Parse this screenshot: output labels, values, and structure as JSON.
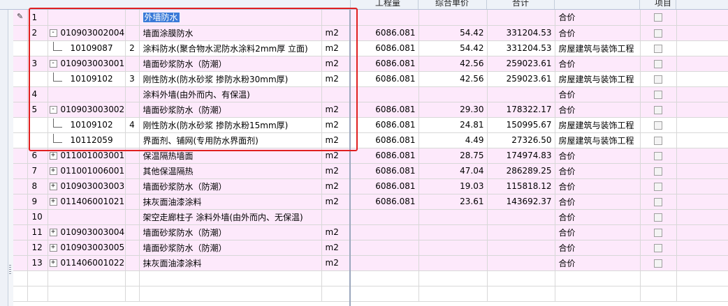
{
  "header": {
    "quantity": "工程量",
    "unit_price": "综合单价",
    "total": "合计",
    "item": "项目"
  },
  "rows": [
    {
      "idx": "1",
      "code": "",
      "seq": "",
      "name": "外墙防水",
      "unit": "",
      "qty": "",
      "price": "",
      "total": "",
      "type": "合价",
      "bg": "pink",
      "tree": "none",
      "selected": true
    },
    {
      "idx": "2",
      "code": "010903002004",
      "seq": "",
      "name": "墙面涂膜防水",
      "unit": "m2",
      "qty": "6086.081",
      "price": "54.42",
      "total": "331204.53",
      "type": "合价",
      "bg": "pink",
      "tree": "minus"
    },
    {
      "idx": "",
      "code": "10109087",
      "seq": "2",
      "name": "涂料防水(聚合物水泥防水涂料2mm厚 立面)",
      "unit": "m2",
      "qty": "6086.081",
      "price": "54.42",
      "total": "331204.53",
      "type": "房屋建筑与装饰工程",
      "bg": "white",
      "tree": "child"
    },
    {
      "idx": "3",
      "code": "010903003001",
      "seq": "",
      "name": "墙面砂浆防水（防潮）",
      "unit": "m2",
      "qty": "6086.081",
      "price": "42.56",
      "total": "259023.61",
      "type": "合价",
      "bg": "pink",
      "tree": "minus"
    },
    {
      "idx": "",
      "code": "10109102",
      "seq": "3",
      "name": "刚性防水(防水砂浆 掺防水粉30mm厚)",
      "unit": "m2",
      "qty": "6086.081",
      "price": "42.56",
      "total": "259023.61",
      "type": "房屋建筑与装饰工程",
      "bg": "white",
      "tree": "child"
    },
    {
      "idx": "4",
      "code": "",
      "seq": "",
      "name": "涂料外墙(由外而内、有保温)",
      "unit": "",
      "qty": "",
      "price": "",
      "total": "",
      "type": "合价",
      "bg": "pink",
      "tree": "none"
    },
    {
      "idx": "5",
      "code": "010903003002",
      "seq": "",
      "name": "墙面砂浆防水（防潮）",
      "unit": "m2",
      "qty": "6086.081",
      "price": "29.30",
      "total": "178322.17",
      "type": "合价",
      "bg": "pink",
      "tree": "minus"
    },
    {
      "idx": "",
      "code": "10109102",
      "seq": "4",
      "name": "刚性防水(防水砂浆 掺防水粉15mm厚)",
      "unit": "m2",
      "qty": "6086.081",
      "price": "24.81",
      "total": "150995.67",
      "type": "房屋建筑与装饰工程",
      "bg": "white",
      "tree": "child"
    },
    {
      "idx": "",
      "code": "10112059",
      "seq": "",
      "name": "界面剂、铺网(专用防水界面剂)",
      "unit": "m2",
      "qty": "6086.081",
      "price": "4.49",
      "total": "27326.50",
      "type": "房屋建筑与装饰工程",
      "bg": "white",
      "tree": "child"
    },
    {
      "idx": "6",
      "code": "011001003001",
      "seq": "",
      "name": "保温隔热墙面",
      "unit": "m2",
      "qty": "6086.081",
      "price": "28.75",
      "total": "174974.83",
      "type": "合价",
      "bg": "pink",
      "tree": "plus"
    },
    {
      "idx": "7",
      "code": "011001006001",
      "seq": "",
      "name": "其他保温隔热",
      "unit": "m2",
      "qty": "6086.081",
      "price": "47.04",
      "total": "286289.25",
      "type": "合价",
      "bg": "pink",
      "tree": "plus"
    },
    {
      "idx": "8",
      "code": "010903003003",
      "seq": "",
      "name": "墙面砂浆防水（防潮）",
      "unit": "m2",
      "qty": "6086.081",
      "price": "19.03",
      "total": "115818.12",
      "type": "合价",
      "bg": "pink",
      "tree": "plus"
    },
    {
      "idx": "9",
      "code": "011406001021",
      "seq": "",
      "name": "抹灰面油漆涂料",
      "unit": "m2",
      "qty": "6086.081",
      "price": "23.61",
      "total": "143692.37",
      "type": "合价",
      "bg": "pink",
      "tree": "plus"
    },
    {
      "idx": "10",
      "code": "",
      "seq": "",
      "name": "架空走廊柱子 涂料外墙(由外而内、无保温)",
      "unit": "",
      "qty": "",
      "price": "",
      "total": "",
      "type": "合价",
      "bg": "pink",
      "tree": "none"
    },
    {
      "idx": "11",
      "code": "010903003004",
      "seq": "",
      "name": "墙面砂浆防水（防潮）",
      "unit": "m2",
      "qty": "",
      "price": "",
      "total": "",
      "type": "合价",
      "bg": "pink",
      "tree": "plus"
    },
    {
      "idx": "12",
      "code": "010903003005",
      "seq": "",
      "name": "墙面砂浆防水（防潮）",
      "unit": "m2",
      "qty": "",
      "price": "",
      "total": "",
      "type": "合价",
      "bg": "pink",
      "tree": "plus"
    },
    {
      "idx": "13",
      "code": "011406001022",
      "seq": "",
      "name": "抹灰面油漆涂料",
      "unit": "m2",
      "qty": "",
      "price": "",
      "total": "",
      "type": "合价",
      "bg": "pink",
      "tree": "plus"
    }
  ],
  "tree_icons": {
    "minus": "-",
    "plus": "+"
  },
  "colors": {
    "row_pink": "#fde9fb",
    "selection": "#3b7ad8",
    "highlight_box": "#e02020"
  }
}
